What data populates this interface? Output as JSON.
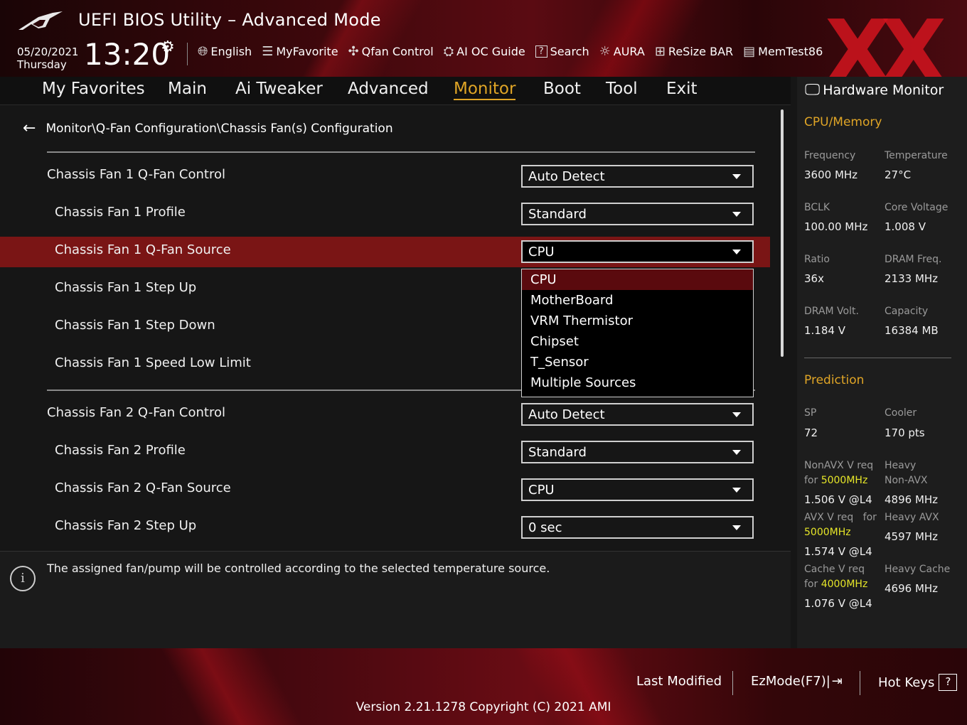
{
  "header": {
    "title": "UEFI BIOS Utility – Advanced Mode",
    "date": "05/20/2021",
    "day": "Thursday",
    "time": "13:20",
    "toolbar": [
      {
        "label": "English",
        "icon": "globe-icon"
      },
      {
        "label": "MyFavorite",
        "icon": "favorite-list-icon"
      },
      {
        "label": "Qfan Control",
        "icon": "fan-icon"
      },
      {
        "label": "AI OC Guide",
        "icon": "ai-chip-icon"
      },
      {
        "label": "Search",
        "icon": "search-help-icon"
      },
      {
        "label": "AURA",
        "icon": "aura-light-icon"
      },
      {
        "label": "ReSize BAR",
        "icon": "resize-bar-icon"
      },
      {
        "label": "MemTest86",
        "icon": "memory-icon"
      }
    ],
    "watermark": "XX"
  },
  "nav": {
    "tabs": [
      "My Favorites",
      "Main",
      "Ai Tweaker",
      "Advanced",
      "Monitor",
      "Boot",
      "Tool",
      "Exit"
    ],
    "active": "Monitor"
  },
  "breadcrumb": "Monitor\\Q-Fan Configuration\\Chassis Fan(s) Configuration",
  "settings": [
    {
      "label": "Chassis Fan 1 Q-Fan Control",
      "value": "Auto Detect"
    },
    {
      "label": "Chassis Fan 1 Profile",
      "value": "Standard"
    },
    {
      "label": "Chassis Fan 1 Q-Fan Source",
      "value": "CPU"
    },
    {
      "label": "Chassis Fan 1 Step Up",
      "value": ""
    },
    {
      "label": "Chassis Fan 1 Step Down",
      "value": ""
    },
    {
      "label": "Chassis Fan 1 Speed Low Limit",
      "value": ""
    },
    {
      "label": "Chassis Fan 2 Q-Fan Control",
      "value": "Auto Detect"
    },
    {
      "label": "Chassis Fan 2 Profile",
      "value": "Standard"
    },
    {
      "label": "Chassis Fan 2 Q-Fan Source",
      "value": "CPU"
    },
    {
      "label": "Chassis Fan 2 Step Up",
      "value": "0 sec"
    }
  ],
  "dropdown": {
    "options": [
      "CPU",
      "MotherBoard",
      "VRM Thermistor",
      "Chipset",
      "T_Sensor",
      "Multiple Sources"
    ],
    "selected": "CPU"
  },
  "info": "The assigned fan/pump will be controlled according to the selected temperature source.",
  "hw_monitor": {
    "title": "Hardware Monitor",
    "cpu_section": "CPU/Memory",
    "cpu_items": [
      {
        "label": "Frequency",
        "value": "3600 MHz"
      },
      {
        "label": "Temperature",
        "value": "27°C"
      },
      {
        "label": "BCLK",
        "value": "100.00 MHz"
      },
      {
        "label": "Core Voltage",
        "value": "1.008 V"
      },
      {
        "label": "Ratio",
        "value": "36x"
      },
      {
        "label": "DRAM Freq.",
        "value": "2133 MHz"
      },
      {
        "label": "DRAM Volt.",
        "value": "1.184 V"
      },
      {
        "label": "Capacity",
        "value": "16384 MB"
      }
    ],
    "prediction_section": "Prediction",
    "sp_label": "SP",
    "sp_value": "72",
    "cooler_label": "Cooler",
    "cooler_value": "170 pts",
    "nonavx_label_1": "NonAVX V req",
    "nonavx_label_2": "for",
    "nonavx_freq": "5000MHz",
    "nonavx_value": "1.506 V @L4",
    "heavy_nonavx_label_1": "Heavy",
    "heavy_nonavx_label_2": "Non-AVX",
    "heavy_nonavx_value": "4896 MHz",
    "avx_label_1": "AVX V req",
    "avx_label_2": "for",
    "avx_freq": "5000MHz",
    "avx_value": "1.574 V @L4",
    "heavy_avx_label": "Heavy AVX",
    "heavy_avx_value": "4597 MHz",
    "cache_label_1": "Cache V req",
    "cache_label_2": "for",
    "cache_freq": "4000MHz",
    "cache_value": "1.076 V @L4",
    "heavy_cache_label": "Heavy Cache",
    "heavy_cache_value": "4696 MHz"
  },
  "footer": {
    "last_modified": "Last Modified",
    "ezmode": "EzMode(F7)|",
    "ezmode_icon": "exit-arrow-icon",
    "hotkeys": "Hot Keys",
    "hotkeys_key": "?",
    "version": "Version 2.21.1278 Copyright (C) 2021 AMI"
  },
  "colors": {
    "accent": "#e0a526",
    "highlight_row": "#7a1515",
    "dropdown_selected": "#5a0a0e",
    "prediction_freq": "#e6e628"
  }
}
